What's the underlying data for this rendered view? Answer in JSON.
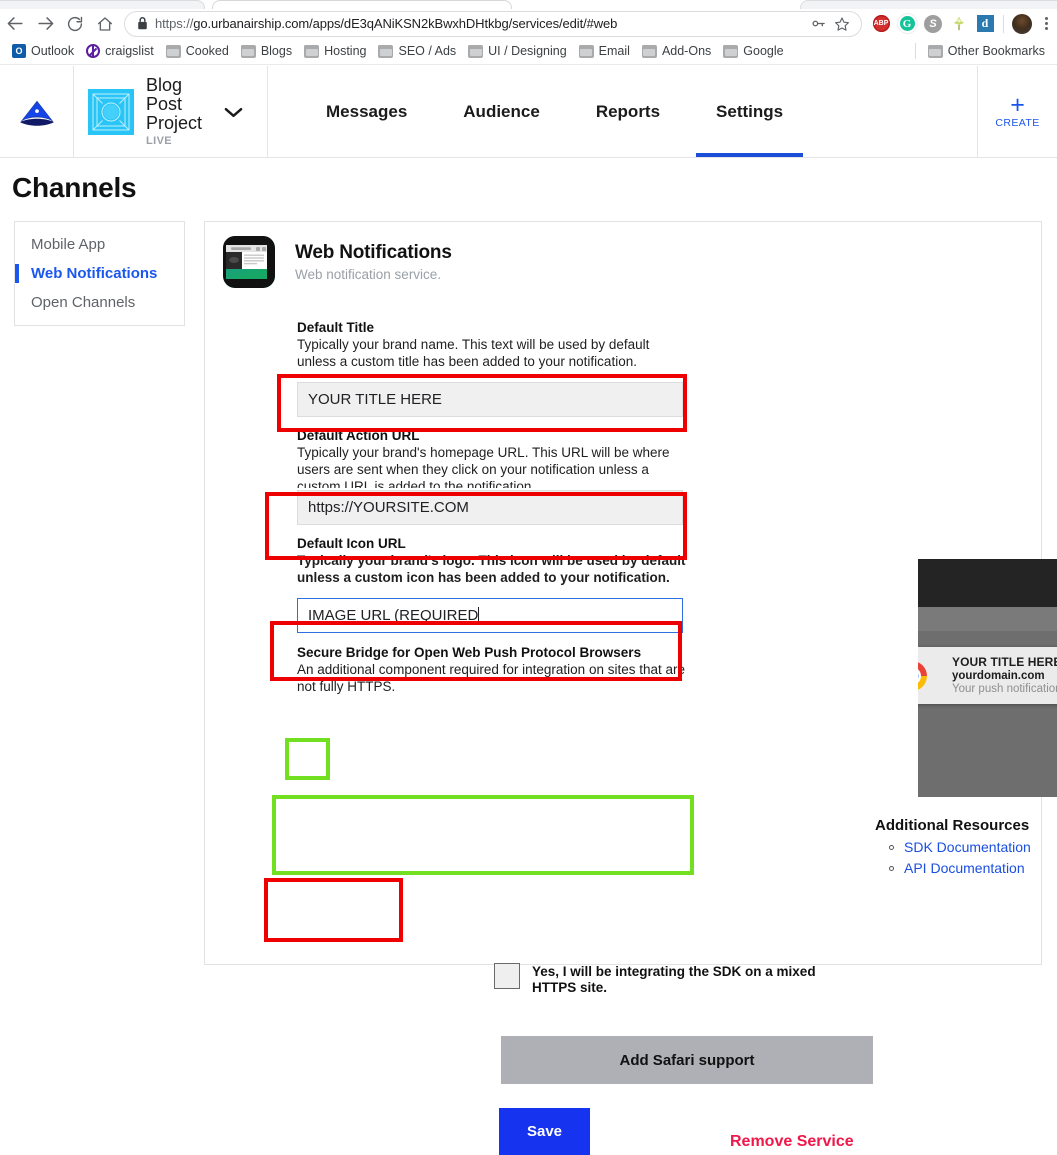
{
  "browser": {
    "url_scheme": "https://",
    "url_rest": "go.urbanairship.com/apps/dE3qANiKSN2kBwxhDHtkbg/services/edit/#web",
    "back_icon": "back-arrow-icon",
    "forward_icon": "forward-arrow-icon",
    "reload_icon": "reload-icon",
    "home_icon": "home-icon",
    "lock_icon": "lock-icon",
    "key_icon": "key-icon",
    "star_icon": "star-icon",
    "extensions": [
      {
        "name": "adblock-plus-icon",
        "label": "ABP"
      },
      {
        "name": "grammarly-icon",
        "label": "G"
      },
      {
        "name": "skype-icon",
        "label": "S"
      },
      {
        "name": "pushpin-icon",
        "label": ""
      },
      {
        "name": "dashlane-icon",
        "label": "d"
      }
    ],
    "avatar": "user-avatar",
    "menu_icon": "kebab-menu-icon"
  },
  "bookmarks": [
    {
      "label": "Outlook",
      "icon": "outlook-icon"
    },
    {
      "label": "craigslist",
      "icon": "craigslist-icon"
    },
    {
      "label": "Cooked",
      "icon": "folder-icon"
    },
    {
      "label": "Blogs",
      "icon": "folder-icon"
    },
    {
      "label": "Hosting",
      "icon": "folder-icon"
    },
    {
      "label": "SEO / Ads",
      "icon": "folder-icon"
    },
    {
      "label": "UI / Designing",
      "icon": "folder-icon"
    },
    {
      "label": "Email",
      "icon": "folder-icon"
    },
    {
      "label": "Add-Ons",
      "icon": "folder-icon"
    },
    {
      "label": "Google",
      "icon": "folder-icon"
    }
  ],
  "bookmarks_other": {
    "label": "Other Bookmarks",
    "icon": "folder-icon"
  },
  "app_header": {
    "brand_logo": "urban-airship-logo",
    "project_name": "Blog Post Project",
    "project_status": "LIVE",
    "project_chevron": "chevron-down-icon",
    "nav": [
      {
        "label": "Messages",
        "active": false
      },
      {
        "label": "Audience",
        "active": false
      },
      {
        "label": "Reports",
        "active": false
      },
      {
        "label": "Settings",
        "active": true
      }
    ],
    "create_plus": "+",
    "create_label": "CREATE"
  },
  "page": {
    "title": "Channels"
  },
  "side_nav": [
    {
      "label": "Mobile App",
      "active": false
    },
    {
      "label": "Web Notifications",
      "active": true
    },
    {
      "label": "Open Channels",
      "active": false
    }
  ],
  "service": {
    "icon": "web-notifications-icon",
    "title": "Web Notifications",
    "subtitle": "Web notification service."
  },
  "fields": {
    "default_title": {
      "label": "Default Title",
      "description": "Typically your brand name. This text will be used by default unless a custom title has been added to your notification.",
      "value": "YOUR TITLE HERE"
    },
    "default_action_url": {
      "label": "Default Action URL",
      "description": "Typically your brand's homepage URL. This URL will be where users are sent when they click on your notification unless a custom URL is added to the notification.",
      "value": "https://YOURSITE.COM"
    },
    "default_icon_url": {
      "label": "Default Icon URL",
      "description": "Typically your brand's logo. This icon will be used by default unless a custom icon has been added to your notification.",
      "value": "IMAGE URL (REQUIRED"
    },
    "secure_bridge": {
      "label": "Secure Bridge for Open Web Push Protocol Browsers",
      "description": "An additional component required for integration on sites that are not fully HTTPS.",
      "checkbox_label": "Yes, I will be integrating the SDK on a mixed HTTPS site.",
      "checked": false
    }
  },
  "buttons": {
    "safari": "Add Safari support",
    "save": "Save",
    "remove": "Remove Service"
  },
  "preview": {
    "toast_title": "YOUR TITLE HERE",
    "toast_domain": "yourdomain.com",
    "toast_body": "Your push notification text.",
    "browser_icon": "chrome-logo-icon",
    "image_placeholder": "broken-image-icon"
  },
  "resources": {
    "title": "Additional Resources",
    "links": [
      {
        "label": "SDK Documentation"
      },
      {
        "label": "API Documentation"
      }
    ]
  },
  "annotations": {
    "red_color": "#ee0000",
    "green_color": "#72e020"
  }
}
